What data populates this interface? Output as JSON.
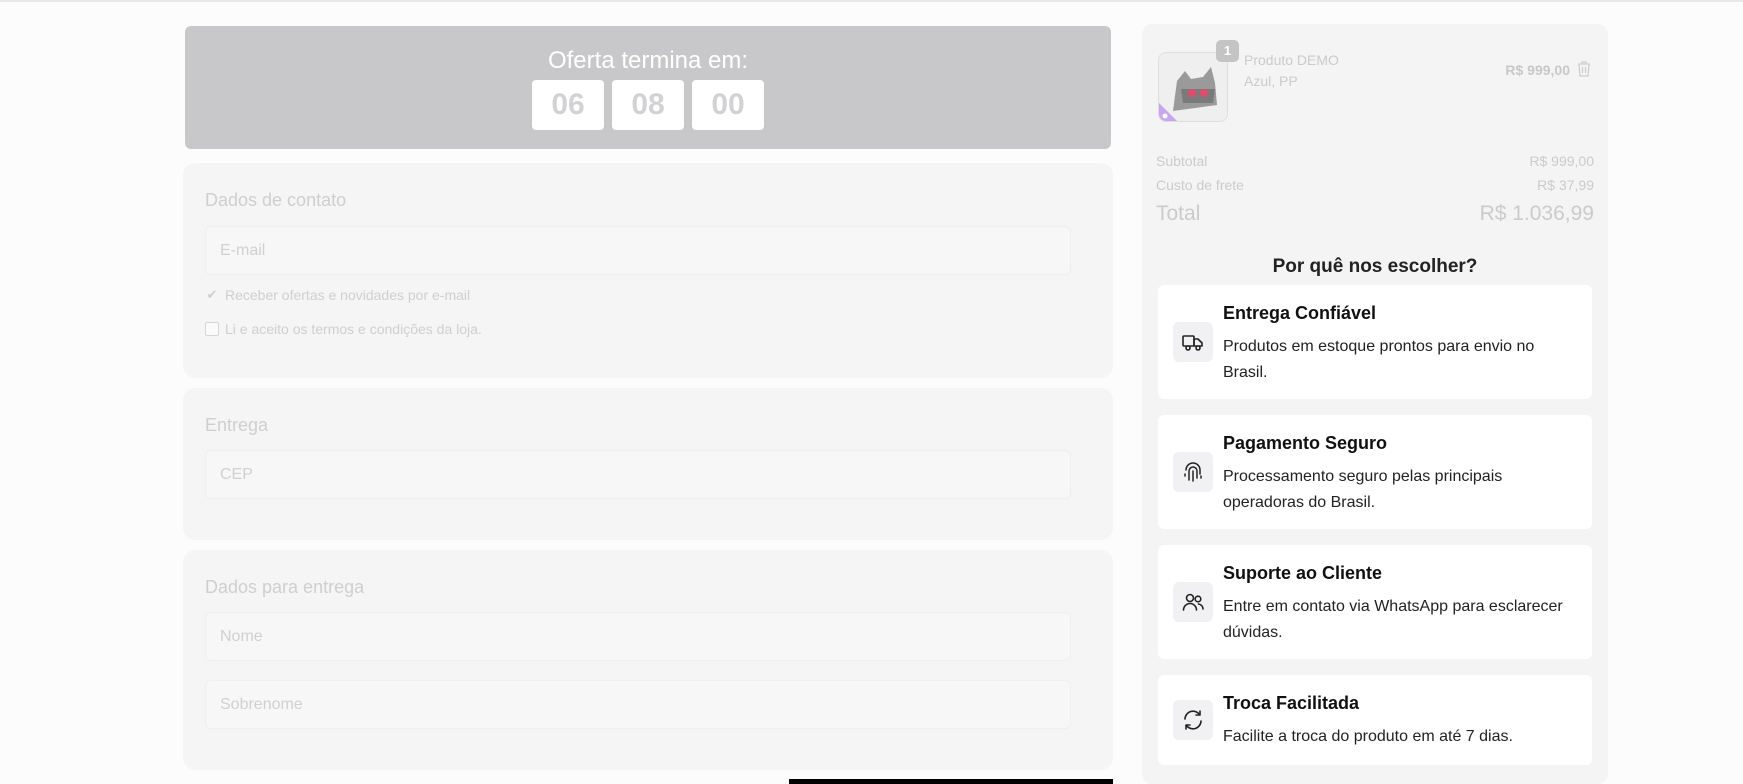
{
  "timer": {
    "title": "Oferta termina em:",
    "hours": "06",
    "minutes": "08",
    "seconds": "00"
  },
  "contact": {
    "title": "Dados de contato",
    "email_placeholder": "E-mail",
    "newsletter_label": "Receber ofertas e novidades por e-mail",
    "newsletter_checked": true,
    "terms_label": "Li e aceito os termos e condições da loja.",
    "terms_checked": false
  },
  "delivery": {
    "title": "Entrega",
    "cep_placeholder": "CEP"
  },
  "shipping_data": {
    "title": "Dados para entrega",
    "name_placeholder": "Nome",
    "surname_placeholder": "Sobrenome"
  },
  "cart": {
    "item": {
      "qty": "1",
      "name": "Produto DEMO",
      "variant": "Azul, PP",
      "price": "R$ 999,00"
    },
    "subtotal_label": "Subtotal",
    "subtotal_value": "R$ 999,00",
    "shipping_label": "Custo de frete",
    "shipping_value": "R$ 37,99",
    "total_label": "Total",
    "total_value": "R$ 1.036,99"
  },
  "why": {
    "title": "Por quê nos escolher?",
    "items": [
      {
        "icon": "truck-icon",
        "title": "Entrega Confiável",
        "text": "Produtos em estoque prontos para envio no Brasil."
      },
      {
        "icon": "fingerprint-icon",
        "title": "Pagamento Seguro",
        "text": "Processamento seguro pelas principais operadoras do Brasil."
      },
      {
        "icon": "users-icon",
        "title": "Suporte ao Cliente",
        "text": "Entre em contato via WhatsApp para esclarecer dúvidas."
      },
      {
        "icon": "refresh-icon",
        "title": "Troca Facilitada",
        "text": "Facilite a troca do produto em até 7 dias."
      }
    ]
  },
  "colors": {
    "timer_bg": "#c8c8ca",
    "card_bg": "#f5f5f5",
    "sidebar_bg": "#f4f4f4"
  }
}
